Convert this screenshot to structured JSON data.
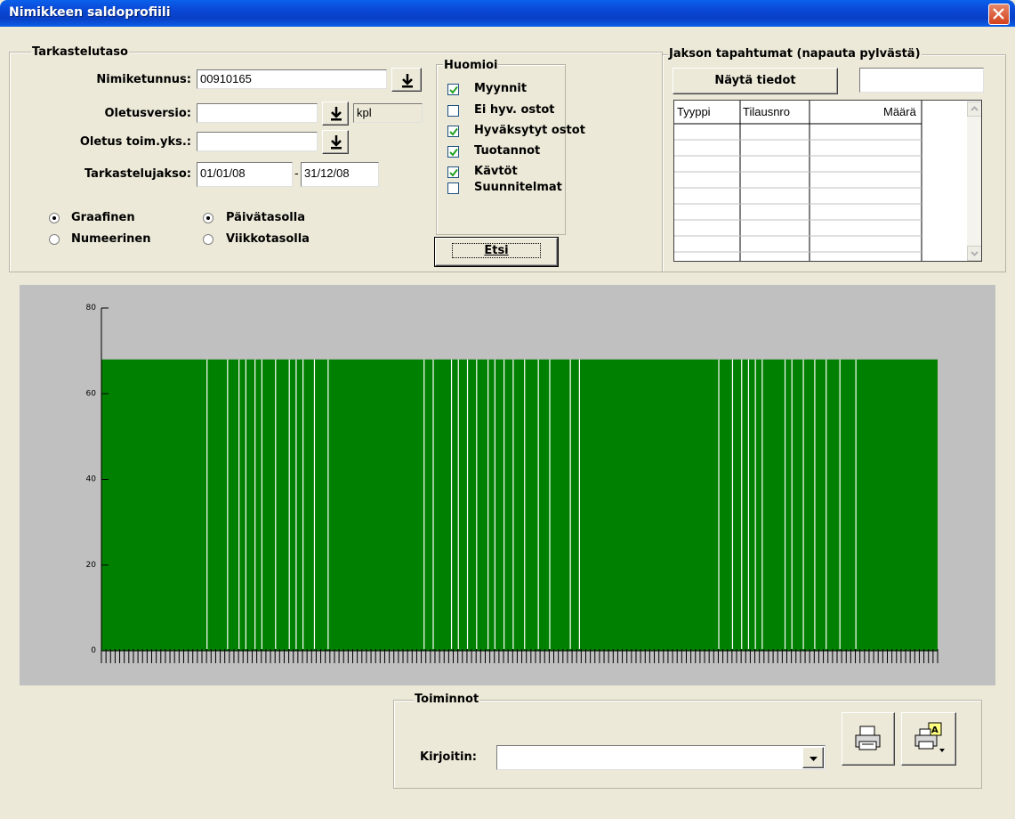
{
  "window": {
    "title": "Nimikkeen saldoprofiili"
  },
  "tarkastelutaso": {
    "legend": "Tarkastelutaso",
    "nimiketunnus_label": "Nimiketunnus:",
    "nimiketunnus_value": "00910165",
    "oletusversio_label": "Oletusversio:",
    "oletusversio_value": "",
    "unit": "kpl",
    "oletus_toim_label": "Oletus toim.yks.:",
    "oletus_toim_value": "",
    "jakso_label": "Tarkastelujakso:",
    "jakso_start": "01/01/08",
    "jakso_sep": "-",
    "jakso_end": "31/12/08",
    "radio_graafinen": "Graafinen",
    "radio_numeerinen": "Numeerinen",
    "radio_paiva": "Päivätasolla",
    "radio_viikko": "Viikkotasolla",
    "graafinen_selected": true,
    "paiva_selected": true
  },
  "huomioi": {
    "legend": "Huomioi",
    "items": [
      {
        "label": "Myynnit",
        "checked": true
      },
      {
        "label": "Ei hyv. ostot",
        "checked": false
      },
      {
        "label": "Hyväksytyt ostot",
        "checked": true
      },
      {
        "label": "Tuotannot",
        "checked": true
      },
      {
        "label": "Kävtöt",
        "checked": true
      },
      {
        "label": "Suunnitelmat",
        "checked": false
      }
    ],
    "etsi_label": "Etsi"
  },
  "jakso": {
    "legend": "Jakson tapahtumat (napauta pylvästä)",
    "nayta_label": "Näytä tiedot",
    "side_value": "",
    "columns": [
      "Tyyppi",
      "Tilausnro",
      "Määrä"
    ]
  },
  "chart_data": {
    "type": "bar",
    "ylim": [
      0,
      80
    ],
    "yticks": [
      "0",
      "20",
      "40",
      "60",
      "80"
    ],
    "value": 68,
    "background": "#c0c0c0",
    "bar_color": "#008000",
    "gap_color": "#ffffff",
    "days": 366,
    "gap_days": [
      46,
      55,
      60,
      63,
      67,
      70,
      76,
      82,
      85,
      88,
      93,
      99,
      141,
      145,
      153,
      156,
      160,
      164,
      169,
      172,
      176,
      180,
      185,
      191,
      196,
      205,
      209,
      270,
      276,
      280,
      283,
      286,
      289,
      299,
      302,
      307,
      312,
      317,
      323,
      330
    ]
  },
  "toiminnot": {
    "legend": "Toiminnot",
    "kirjoitin_label": "Kirjoitin:",
    "kirjoitin_value": ""
  },
  "colors": {
    "titlebar": "#0a47d4",
    "close": "#d2411c",
    "bar": "#008000"
  },
  "icons": [
    "close-icon",
    "down-arrow-icon",
    "checkmark-icon",
    "dropdown-arrow-icon",
    "printer-icon",
    "print-preview-icon"
  ]
}
